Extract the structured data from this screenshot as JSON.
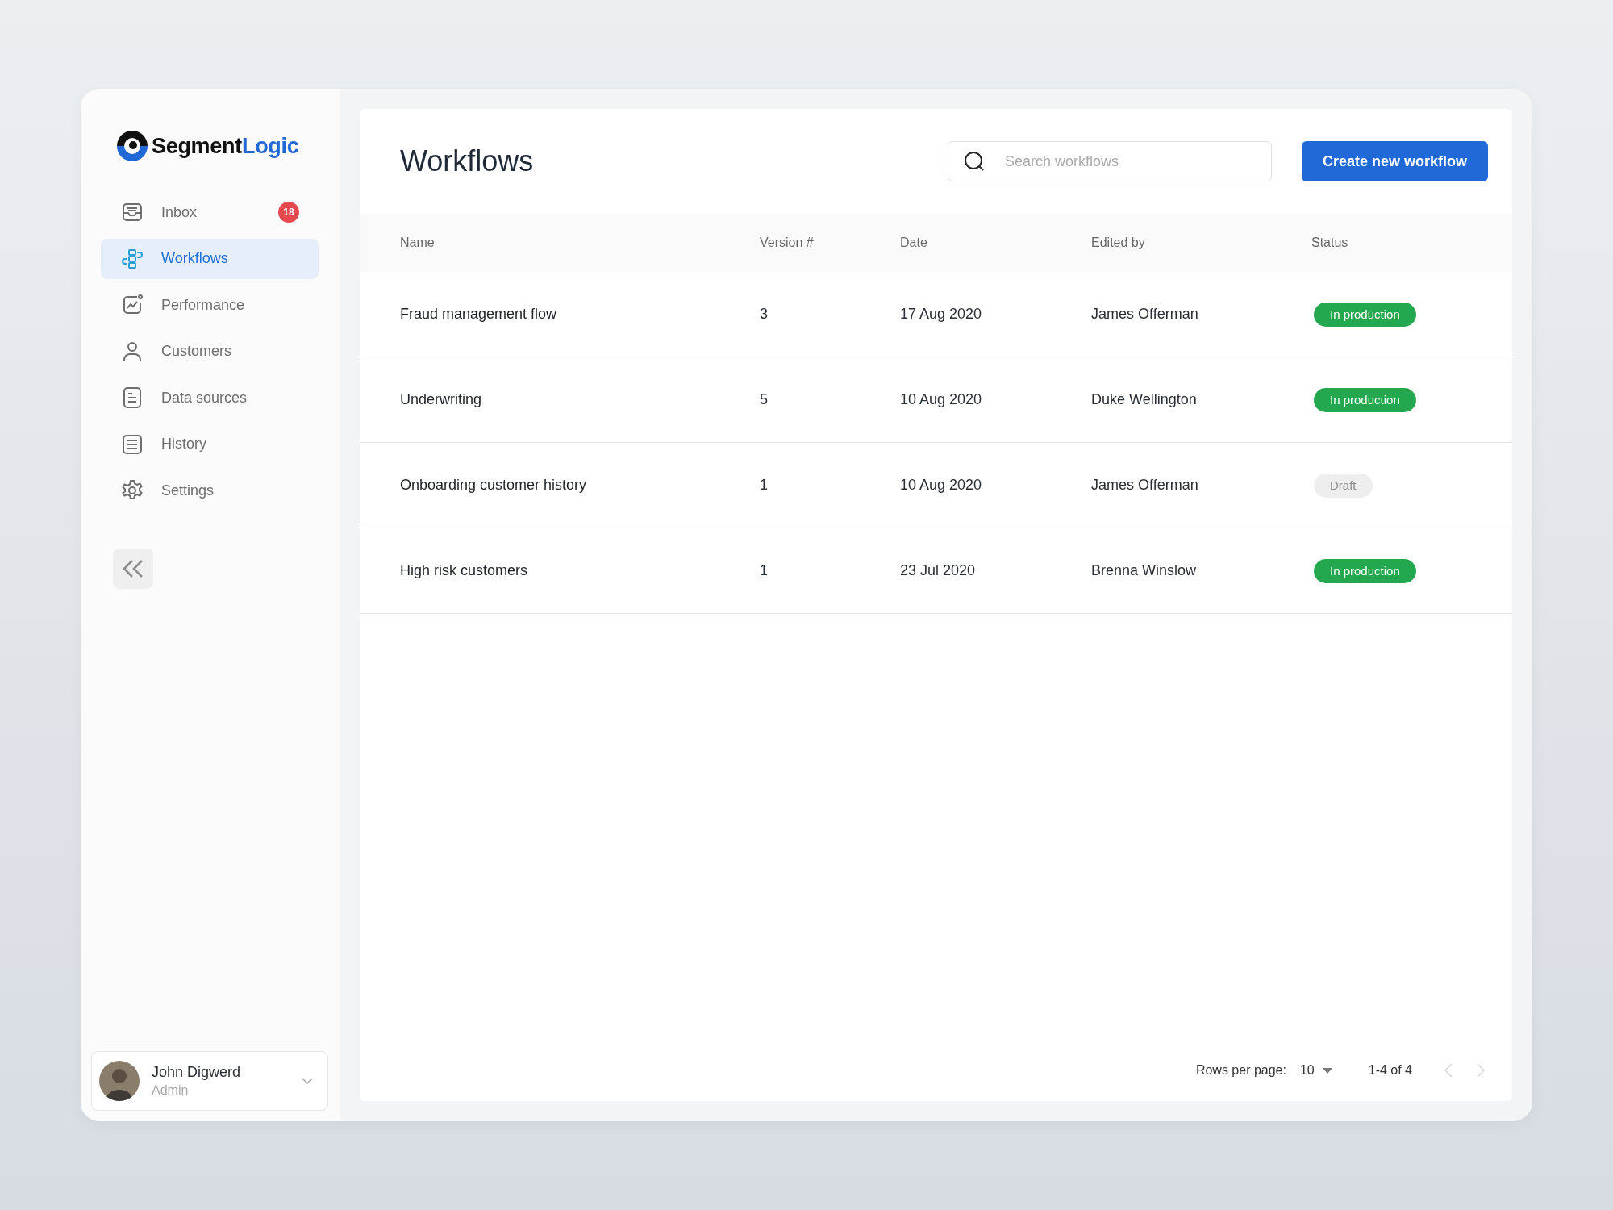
{
  "brand": {
    "name": "Segment",
    "accent": "Logic"
  },
  "nav": [
    {
      "label": "Inbox",
      "kind": "inbox",
      "selected": false,
      "badge": "18"
    },
    {
      "label": "Workflows",
      "kind": "workflow",
      "selected": true
    },
    {
      "label": "Performance",
      "kind": "chart",
      "selected": false
    },
    {
      "label": "Customers",
      "kind": "person",
      "selected": false
    },
    {
      "label": "Data sources",
      "kind": "doc",
      "selected": false
    },
    {
      "label": "History",
      "kind": "list",
      "selected": false
    },
    {
      "label": "Settings",
      "kind": "gear",
      "selected": false
    }
  ],
  "user": {
    "name": "John Digwerd",
    "role": "Admin"
  },
  "page": {
    "title": "Workflows"
  },
  "search": {
    "placeholder": "Search workflows"
  },
  "create_button": "Create new workflow",
  "table": {
    "columns": [
      "Name",
      "Version #",
      "Date",
      "Edited by",
      "Status"
    ],
    "rows": [
      {
        "name": "Fraud management flow",
        "version": "3",
        "date": "17 Aug 2020",
        "edited_by": "James Offerman",
        "status": {
          "label": "In production",
          "kind": "production"
        }
      },
      {
        "name": "Underwriting",
        "version": "5",
        "date": "10 Aug 2020",
        "edited_by": "Duke Wellington",
        "status": {
          "label": "In production",
          "kind": "production"
        }
      },
      {
        "name": "Onboarding customer history",
        "version": "1",
        "date": "10 Aug 2020",
        "edited_by": "James Offerman",
        "status": {
          "label": "Draft",
          "kind": "draft"
        }
      },
      {
        "name": "High risk customers",
        "version": "1",
        "date": "23 Jul 2020",
        "edited_by": "Brenna Winslow",
        "status": {
          "label": "In production",
          "kind": "production"
        }
      }
    ]
  },
  "pagination": {
    "rows_per_page_label": "Rows per page:",
    "rows_per_page": "10",
    "range": "1-4 of 4",
    "prev": {
      "disabled": true
    },
    "next": {
      "disabled": true
    }
  }
}
